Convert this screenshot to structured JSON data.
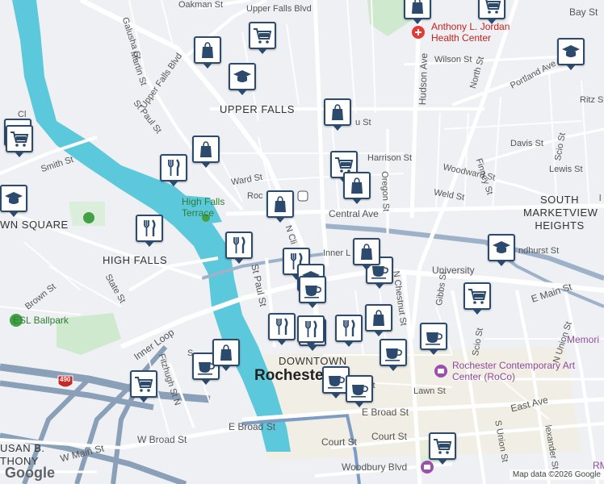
{
  "map": {
    "neighborhoods": [
      "UPPER FALLS",
      "HIGH FALLS",
      "DOWNTOWN",
      "SOUTH MARKETVIEW HEIGHTS",
      "WN SQUARE",
      "USAN B. THONY"
    ],
    "city": "Rochester",
    "poi": {
      "health_center": "Anthony L. Jordan Health Center",
      "ballpark": "ESL Ballpark",
      "terrace": "High Falls Terrace",
      "art_center": "Rochester Contemporary Art Center (RoCo)",
      "memorial": "Memori",
      "rm": "RM"
    },
    "streets": {
      "oakman": "Oakman St",
      "upper_falls_blvd_top": "Upper Falls Blvd",
      "galusha": "Galusha St",
      "upper_falls_blvd": "Upper Falls Blvd",
      "martin": "Martin St",
      "st_paul_n": "St Paul St",
      "smith": "Smith St",
      "cl": "Cl",
      "ward": "Ward St",
      "roc": "Roc",
      "n_cli": "N Cli",
      "central": "Central Ave",
      "harrison": "Harrison St",
      "woodward": "Woodward St",
      "davis": "Davis St",
      "lewis": "Lewis St",
      "weld": "Weld St",
      "oregon": "Oregon St",
      "finney": "Finney St",
      "scio_n": "Scio St",
      "wilson": "Wilson St",
      "hudson": "Hudson Ave",
      "north": "North St",
      "portland": "Portland Ave",
      "ritz": "Ritz St",
      "bay": "Bay St",
      "u_street": "u St",
      "inner_loop_e": "Inner L",
      "inner_loop_w": "Inner Loop",
      "lyndhurst": "ndhurst St",
      "university": "University",
      "n_chestnut": "N Chestnut St",
      "gibbs": "Gibbs St",
      "e_main": "E Main St",
      "n_union": "N Union St",
      "scio_s": "Scio St",
      "st_paul_s": "St Paul St",
      "brown": "Brown St",
      "state": "State St",
      "fitzhugh": "Fitzhugh St N",
      "s": "S",
      "lawn": "Lawn St",
      "e_broad": "E Broad St",
      "e_broad_2": "E Broad St",
      "w_broad": "W Broad St",
      "w_main": "W Main St",
      "court": "Court St",
      "court_2": "Court St",
      "woodbury": "Woodbury Blvd",
      "east_ave": "East Ave",
      "s_union": "S Union St",
      "alexander": "lexander St",
      "st": "st",
      "wilde": "W",
      "i490": "490",
      "right_edge": "l"
    },
    "markers": [
      {
        "type": "shopping"
      },
      {
        "type": "shopping"
      },
      {
        "type": "shopping"
      },
      {
        "type": "school"
      },
      {
        "type": "shopping"
      },
      {
        "type": "school"
      },
      {
        "type": "shopping"
      },
      {
        "type": "shopping"
      },
      {
        "type": "shopping"
      },
      {
        "type": "school"
      },
      {
        "type": "restaurant"
      },
      {
        "type": "shopping"
      },
      {
        "type": "shopping"
      },
      {
        "type": "shopping"
      },
      {
        "type": "restaurant"
      },
      {
        "type": "restaurant"
      },
      {
        "type": "shopping"
      },
      {
        "type": "cafe"
      },
      {
        "type": "school"
      },
      {
        "type": "restaurant"
      },
      {
        "type": "school"
      },
      {
        "type": "cafe"
      },
      {
        "type": "shopping"
      },
      {
        "type": "restaurant"
      },
      {
        "type": "shopping"
      },
      {
        "type": "restaurant"
      },
      {
        "type": "cafe"
      },
      {
        "type": "restaurant"
      },
      {
        "type": "cafe"
      },
      {
        "type": "cafe"
      },
      {
        "type": "cafe"
      },
      {
        "type": "shopping"
      },
      {
        "type": "shopping"
      },
      {
        "type": "cafe"
      },
      {
        "type": "cafe"
      },
      {
        "type": "shopping"
      },
      {
        "type": "shopping"
      }
    ],
    "colors": {
      "marker_border": "#2b4a6e",
      "water": "#4fc3d9",
      "road": "#ffffff",
      "park": "#c8e6c9",
      "highway": "#8aa0b8"
    }
  },
  "footer": {
    "logo": "Google",
    "attribution": "Map data ©2026 Google"
  }
}
